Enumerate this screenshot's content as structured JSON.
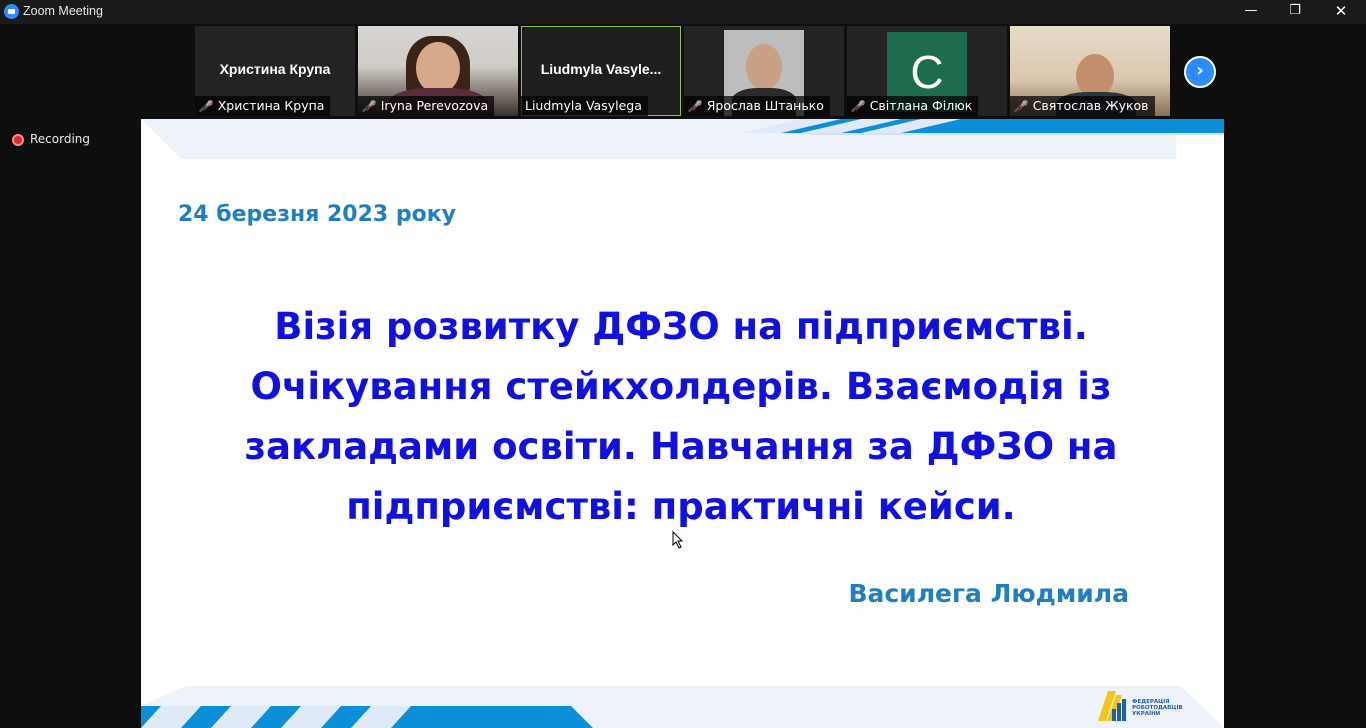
{
  "window": {
    "title": "Zoom Meeting",
    "min_glyph": "—",
    "max_glyph": "❐",
    "close_glyph": "✕"
  },
  "gallery": {
    "tiles": [
      {
        "name": "Христина Крупа",
        "display_name": "Христина Крупа",
        "muted": true,
        "video": false
      },
      {
        "name": "Iryna Perevozova",
        "muted": true,
        "video": true
      },
      {
        "name": "Liudmyla Vasylega",
        "display_name": "Liudmyla  Vasyle...",
        "muted": false,
        "video": false,
        "active_speaker": true
      },
      {
        "name": "Ярослав Штанько",
        "muted": true,
        "video": true
      },
      {
        "name": "Світлана Філюк",
        "avatar_letter": "C",
        "muted": true,
        "video": false
      },
      {
        "name": "Святослав Жуков",
        "muted": true,
        "video": true
      }
    ],
    "next_glyph": "›",
    "muted_icon": "mic-muted-icon"
  },
  "recording": {
    "label": "Recording"
  },
  "slide": {
    "date": "24 березня 2023 року",
    "title_lines": [
      "Візія розвитку ДФЗО на підприємстві.",
      "Очікування стейкхолдерів. Взаємодія із",
      "закладами освіти. Навчання за ДФЗО на",
      "підприємстві: практичні кейси."
    ],
    "author": "Василега Людмила",
    "logo_text": "ФЕДЕРАЦІЯ РОБОТОДАВЦІВ УКРАЇНИ",
    "colors": {
      "title": "#1010e0",
      "accent": "#1f7fbf",
      "band": "#0a8fd8"
    }
  }
}
